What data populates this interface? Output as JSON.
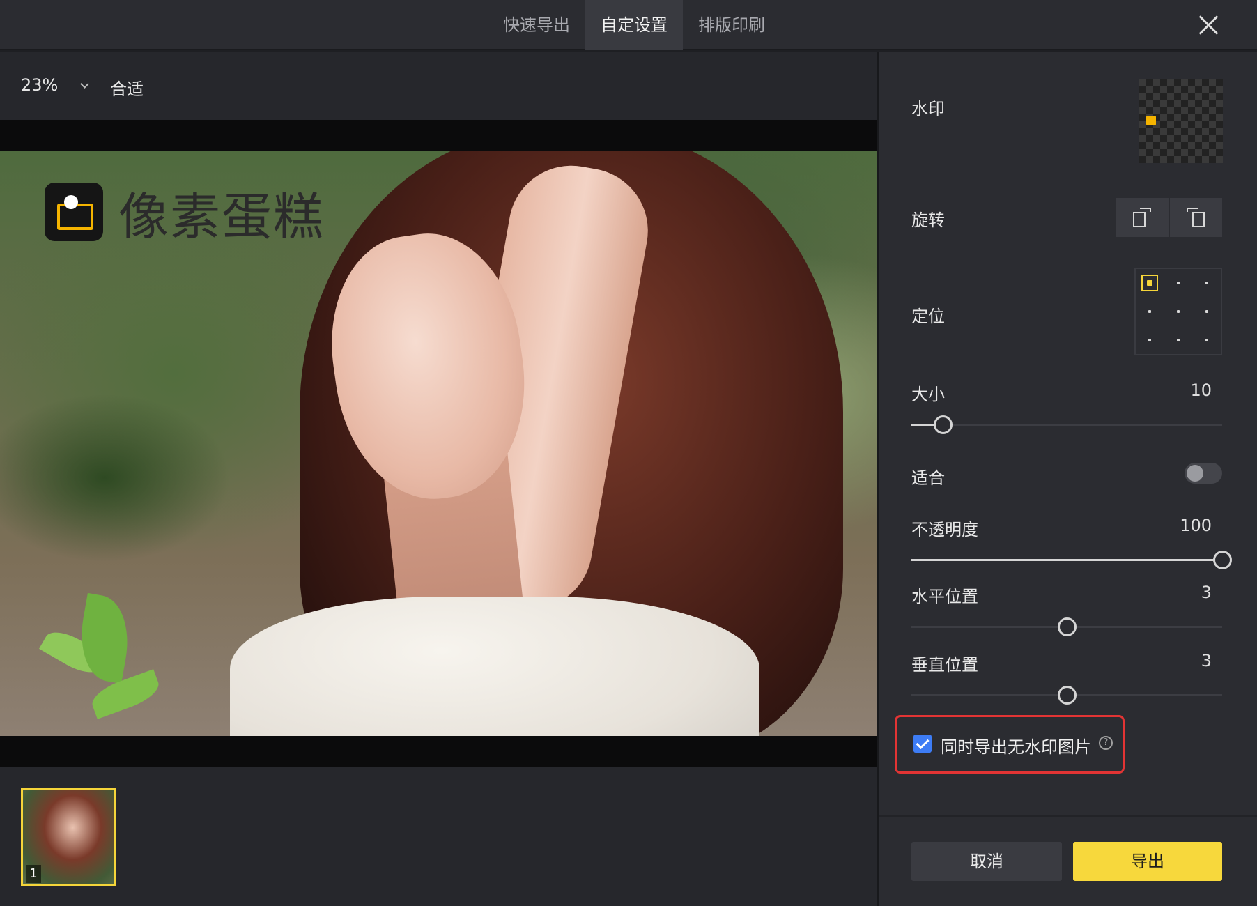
{
  "tabs": [
    {
      "label": "快速导出"
    },
    {
      "label": "自定设置"
    },
    {
      "label": "排版印刷"
    }
  ],
  "active_tab": "自定设置",
  "zoom": {
    "value": "23%",
    "fit_label": "合适"
  },
  "watermark_overlay": {
    "text": "像素蛋糕"
  },
  "filmstrip": {
    "items": [
      {
        "index": "1"
      }
    ]
  },
  "panel": {
    "watermark_label": "水印",
    "rotate_label": "旋转",
    "position_label": "定位",
    "position_selected": "top-left",
    "size": {
      "label": "大小",
      "value": "10",
      "min": 0,
      "max": 100
    },
    "fit": {
      "label": "适合",
      "enabled": false
    },
    "opacity": {
      "label": "不透明度",
      "value": "100",
      "min": 0,
      "max": 100
    },
    "h_position": {
      "label": "水平位置",
      "value": "3",
      "min": 1,
      "max": 5
    },
    "v_position": {
      "label": "垂直位置",
      "value": "3",
      "min": 1,
      "max": 5
    },
    "export_no_watermark": {
      "label": "同时导出无水印图片",
      "checked": true
    },
    "cancel_label": "取消",
    "export_label": "导出"
  },
  "colors": {
    "accent": "#f7d83c",
    "highlight": "#e23434",
    "checkbox": "#3d7cf5"
  },
  "icons": [
    "close-icon",
    "chevron-down-icon",
    "rotate-left-icon",
    "rotate-right-icon",
    "help-icon",
    "check-icon"
  ]
}
